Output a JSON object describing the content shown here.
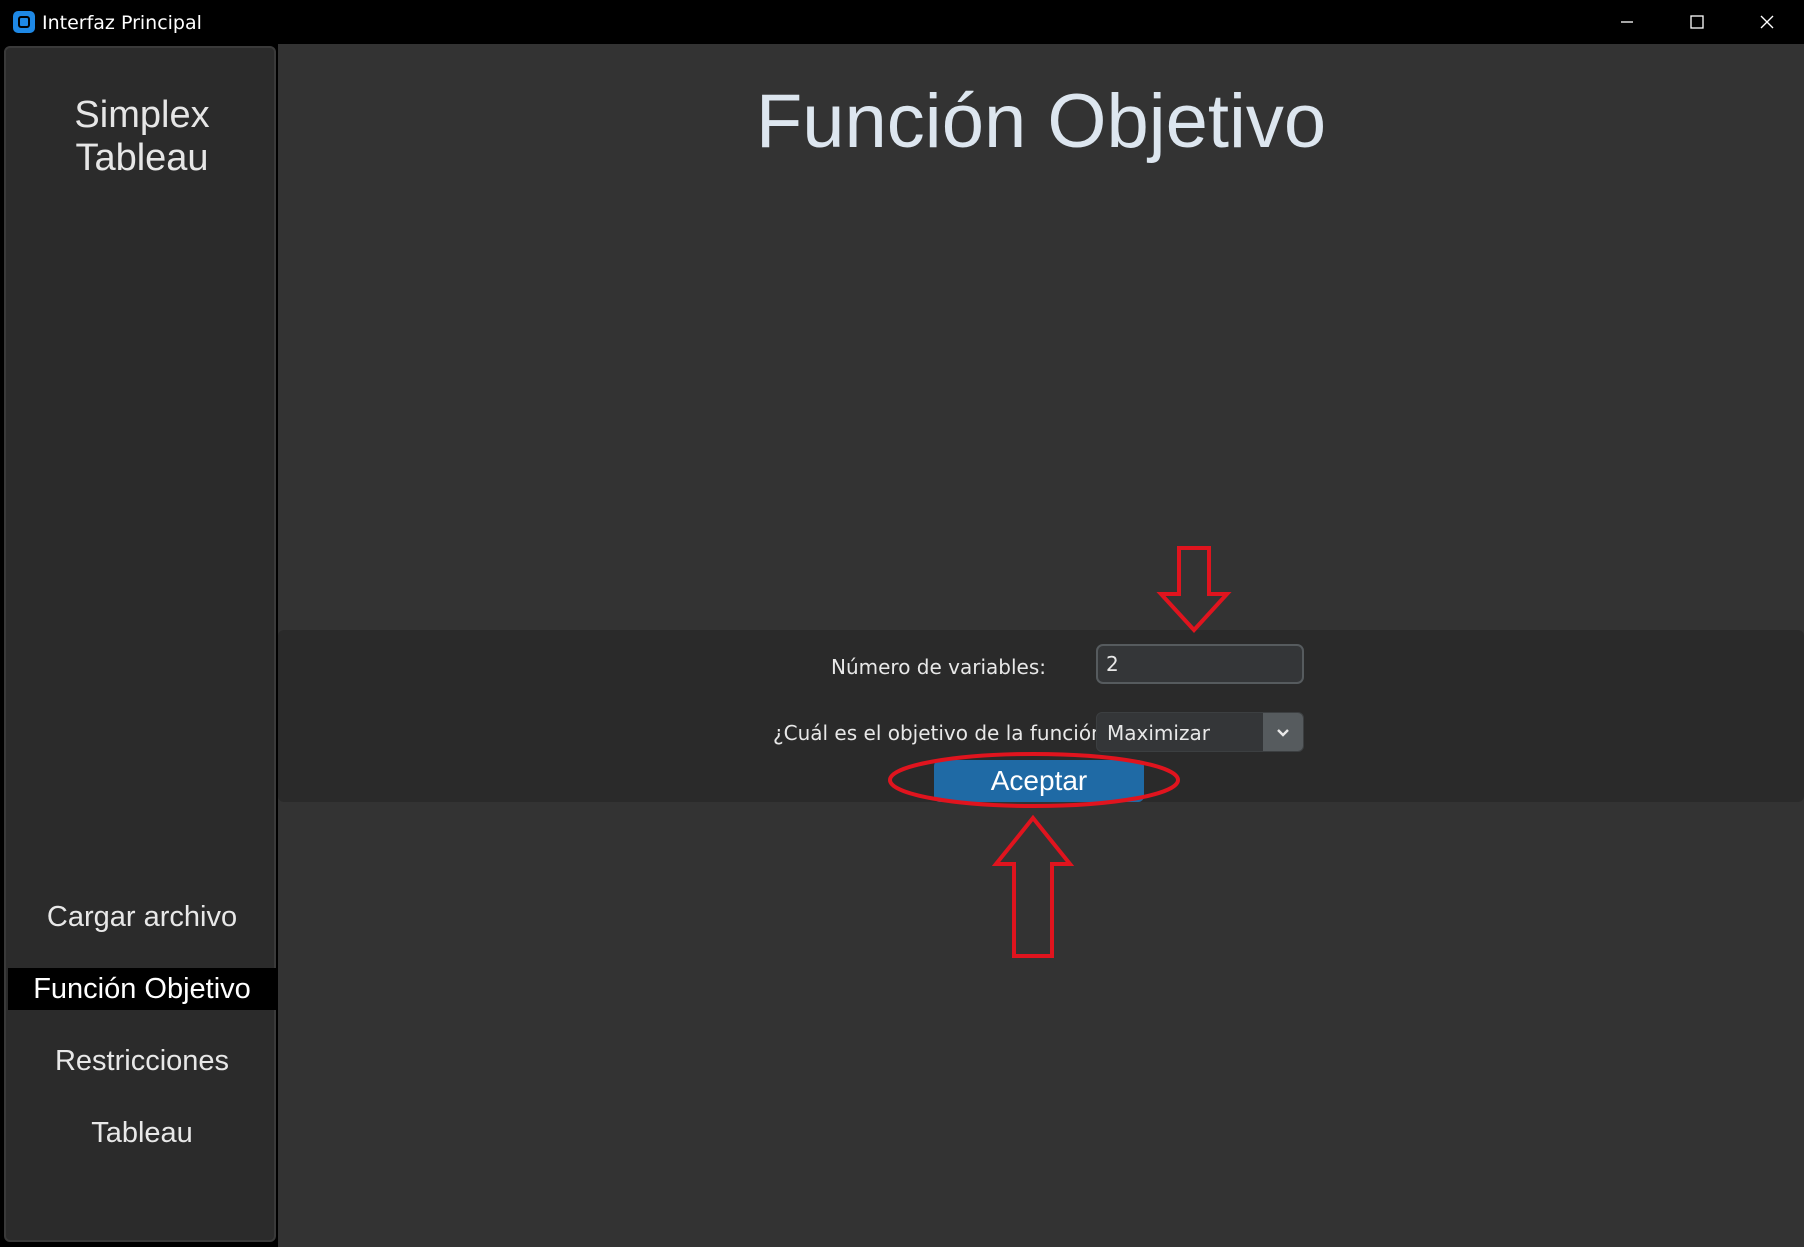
{
  "window": {
    "title": "Interfaz Principal",
    "icon": "app-icon",
    "controls": [
      "minimize-icon",
      "maximize-icon",
      "close-icon"
    ]
  },
  "sidebar": {
    "title": "Simplex Tableau",
    "items": [
      {
        "label": "Cargar archivo",
        "active": false
      },
      {
        "label": "Función Objetivo",
        "active": true
      },
      {
        "label": "Restricciones",
        "active": false
      },
      {
        "label": "Tableau",
        "active": false
      }
    ]
  },
  "main": {
    "title": "Función Objetivo",
    "form": {
      "variables_label": "Número de variables:",
      "variables_value": "2",
      "objective_label": "¿Cuál es el objetivo de la función?",
      "objective_value": "Maximizar",
      "accept_label": "Aceptar"
    }
  },
  "colors": {
    "accent": "#1f6aa5",
    "annotation": "#e0141e",
    "background": "#333333",
    "sidebar": "#2b2b2b"
  }
}
